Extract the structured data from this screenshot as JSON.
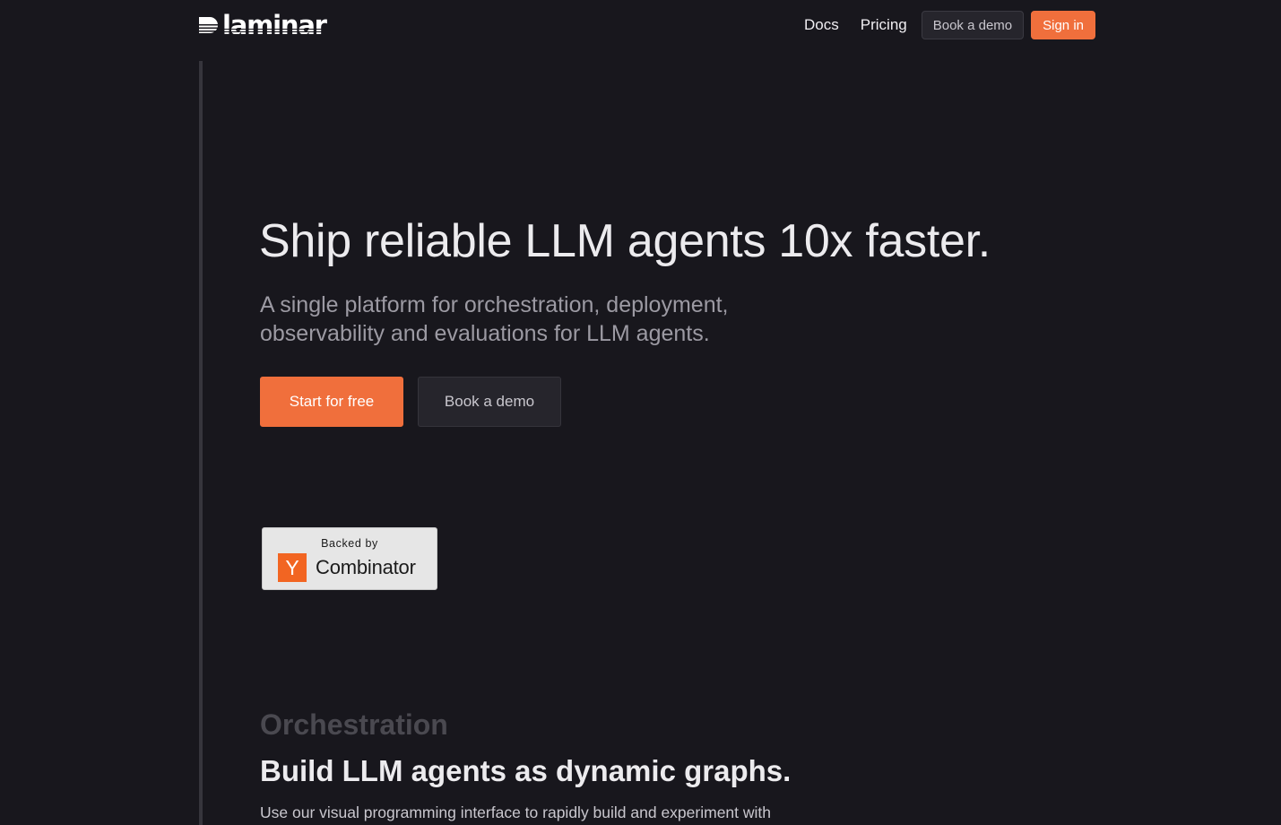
{
  "header": {
    "logo_text": "laminar",
    "nav": {
      "docs": "Docs",
      "pricing": "Pricing",
      "book_demo": "Book a demo",
      "sign_in": "Sign in"
    }
  },
  "hero": {
    "title": "Ship reliable LLM agents 10x faster.",
    "subtitle": "A single platform for orchestration, deployment, observability and evaluations for LLM agents.",
    "cta_primary": "Start for free",
    "cta_secondary": "Book a demo"
  },
  "badge": {
    "backed_by": "Backed by",
    "logo_letter": "Y",
    "name": "Combinator"
  },
  "section": {
    "kicker": "Orchestration",
    "title": "Build LLM agents as dynamic graphs.",
    "body": "Use our visual programming interface to rapidly build and experiment with"
  },
  "colors": {
    "background": "#18171d",
    "accent": "#f06f3c",
    "yc_orange": "#f26522"
  }
}
